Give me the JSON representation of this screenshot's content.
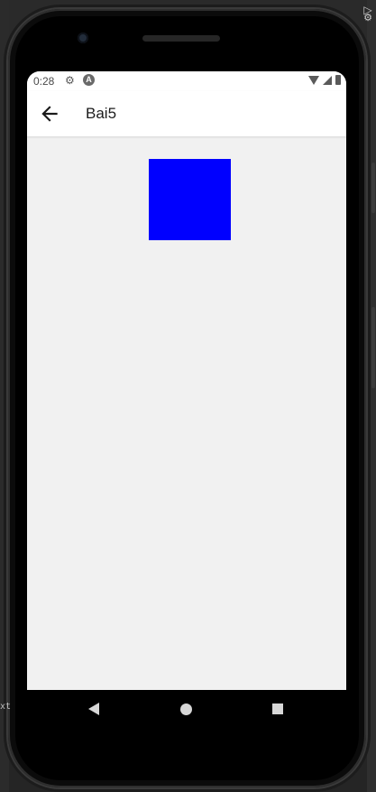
{
  "status_bar": {
    "time": "0:28",
    "icons": [
      "gear-icon",
      "app-a-icon",
      "wifi-icon",
      "signal-icon",
      "battery-icon"
    ]
  },
  "app_bar": {
    "back_icon": "arrow-left-icon",
    "title": "Bai5"
  },
  "content": {
    "box_color": "#0000ff"
  },
  "navigation_bar": {
    "buttons": [
      "back",
      "home",
      "recents"
    ]
  },
  "colors": {
    "screen_background": "#f1f1f1",
    "app_bar_background": "#ffffff",
    "device_frame": "#0b0b0b"
  }
}
